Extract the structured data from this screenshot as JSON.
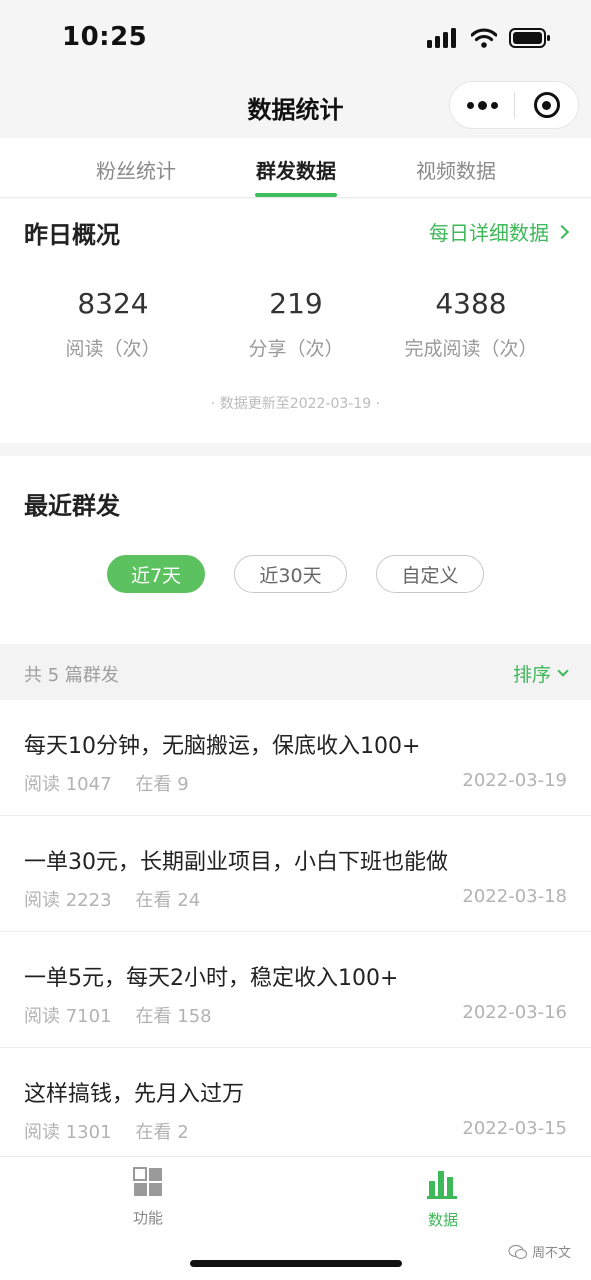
{
  "status_bar": {
    "time": "10:25",
    "icons": [
      "signal-icon",
      "wifi-icon",
      "battery-icon"
    ]
  },
  "nav": {
    "title": "数据统计",
    "capsule": {
      "more_icon": "more-dots-icon",
      "close_icon": "close-circle-icon"
    }
  },
  "tabs": [
    {
      "label": "粉丝统计",
      "active": false
    },
    {
      "label": "群发数据",
      "active": true
    },
    {
      "label": "视频数据",
      "active": false
    }
  ],
  "overview": {
    "title": "昨日概况",
    "detail_link": "每日详细数据",
    "stats": [
      {
        "value": "8324",
        "label": "阅读（次）"
      },
      {
        "value": "219",
        "label": "分享（次）"
      },
      {
        "value": "4388",
        "label": "完成阅读（次）"
      }
    ],
    "update_note": "· 数据更新至2022-03-19 ·"
  },
  "recent": {
    "title": "最近群发",
    "filters": [
      {
        "label": "近7天",
        "active": true
      },
      {
        "label": "近30天",
        "active": false
      },
      {
        "label": "自定义",
        "active": false
      }
    ]
  },
  "summary": {
    "count_text": "共 5 篇群发",
    "sort_label": "排序"
  },
  "articles": [
    {
      "title": "每天10分钟，无脑搬运，保底收入100+",
      "reads": "阅读 1047",
      "watching": "在看 9",
      "date": "2022-03-19"
    },
    {
      "title": "一单30元，长期副业项目，小白下班也能做",
      "reads": "阅读 2223",
      "watching": "在看 24",
      "date": "2022-03-18"
    },
    {
      "title": "一单5元，每天2小时，稳定收入100+",
      "reads": "阅读 7101",
      "watching": "在看 158",
      "date": "2022-03-16"
    },
    {
      "title": "这样搞钱，先月入过万",
      "reads": "阅读 1301",
      "watching": "在看 2",
      "date": "2022-03-15"
    }
  ],
  "tabbar": {
    "items": [
      {
        "label": "功能",
        "icon": "grid-icon",
        "active": false
      },
      {
        "label": "数据",
        "icon": "bar-chart-icon",
        "active": true
      }
    ]
  },
  "watermark": {
    "text": "周不文",
    "icon": "wechat-icon"
  },
  "colors": {
    "accent": "#3fb85a",
    "pill_active": "#5cc15f",
    "background": "#f5f5f5"
  }
}
